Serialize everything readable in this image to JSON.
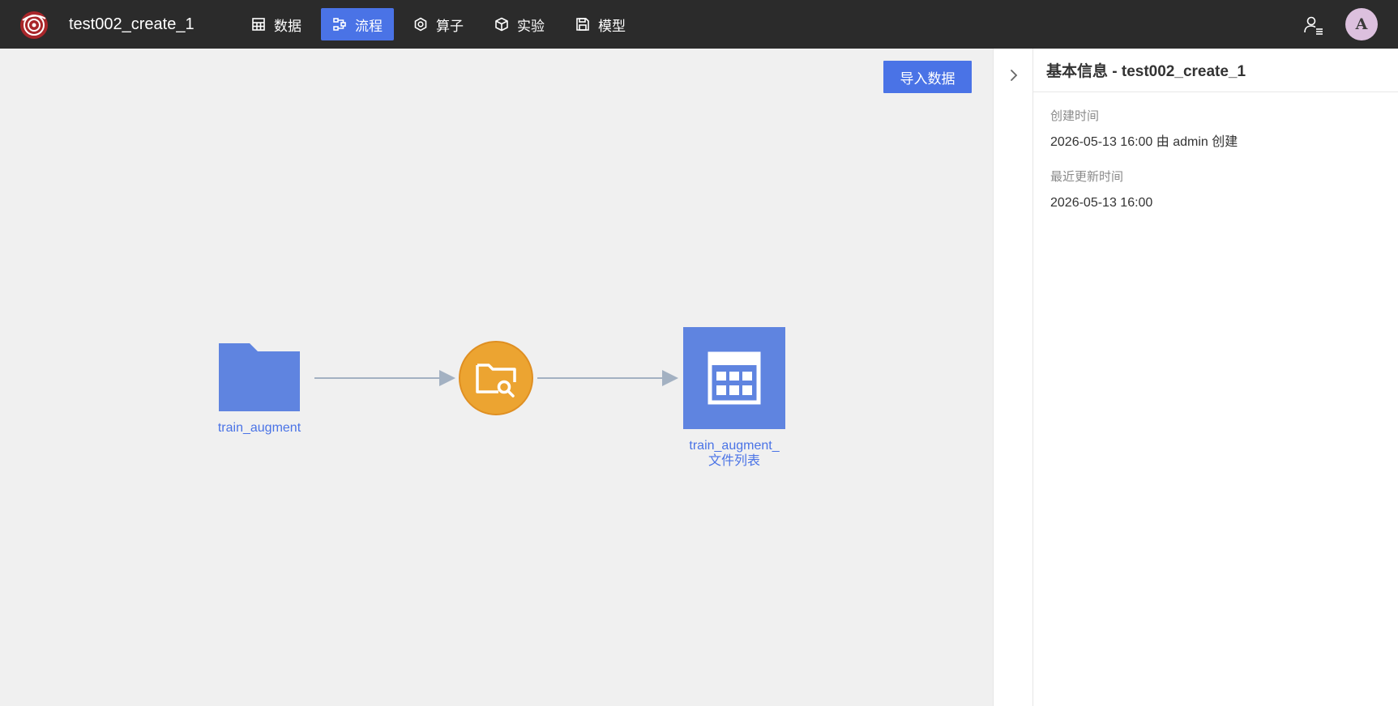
{
  "header": {
    "app_title": "test002_create_1",
    "nav": [
      {
        "label": "数据",
        "icon": "table-icon",
        "active": false
      },
      {
        "label": "流程",
        "icon": "flow-icon",
        "active": true
      },
      {
        "label": "算子",
        "icon": "hexagon-icon",
        "active": false
      },
      {
        "label": "实验",
        "icon": "cube-icon",
        "active": false
      },
      {
        "label": "模型",
        "icon": "save-icon",
        "active": false
      }
    ],
    "avatar_initial": "A"
  },
  "canvas": {
    "import_button_label": "导入数据",
    "nodes": [
      {
        "label": "train_augment",
        "type": "folder-dataset",
        "icon": "folder-icon"
      },
      {
        "label": "",
        "type": "operator",
        "icon": "folder-search-icon"
      },
      {
        "label_line1": "train_augment_",
        "label_line2": "文件列表",
        "type": "table-dataset",
        "icon": "table-icon"
      }
    ]
  },
  "info_panel": {
    "title": "基本信息 - test002_create_1",
    "created_label": "创建时间",
    "created_value": "2026-05-13 16:00  由 admin 创建",
    "updated_label": "最近更新时间",
    "updated_value": "2026-05-13 16:00"
  },
  "colors": {
    "topbar": "#2b2b2b",
    "accent": "#4a73e6",
    "node_blue": "#5f84e0",
    "operator_orange": "#eca431",
    "canvas_bg": "#f0f0f0",
    "edge": "#a3b1c2"
  }
}
